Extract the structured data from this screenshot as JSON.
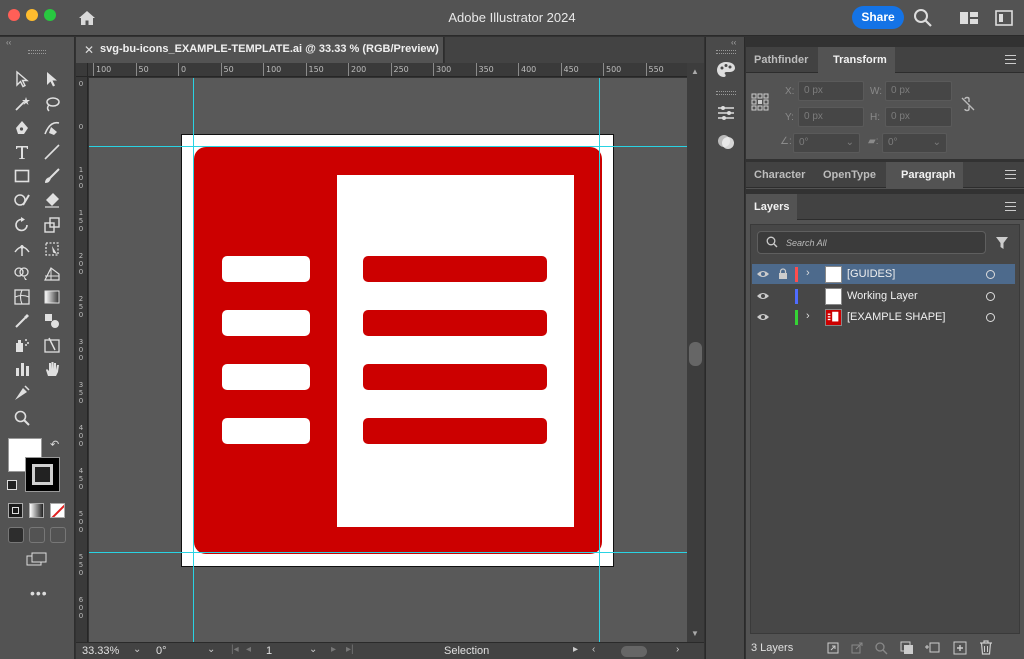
{
  "window": {
    "app_title": "Adobe Illustrator 2024",
    "share_label": "Share"
  },
  "document": {
    "tab_title": "svg-bu-icons_EXAMPLE-TEMPLATE.ai @ 33.33 % (RGB/Preview)",
    "close_glyph": "✕"
  },
  "rulers": {
    "horizontal_ticks": [
      "100",
      "50",
      "0",
      "50",
      "100",
      "150",
      "200",
      "250",
      "300",
      "350",
      "400",
      "450",
      "500",
      "550"
    ],
    "vertical_ticks": [
      "0",
      "0",
      "100",
      "150",
      "200",
      "250",
      "300",
      "350",
      "400",
      "450",
      "500",
      "550",
      "600"
    ]
  },
  "status_bar": {
    "zoom": "33.33%",
    "rotation": "0°",
    "artboard_number": "1",
    "tool_label": "Selection"
  },
  "transform_panel": {
    "tabs": [
      "Pathfinder",
      "Transform"
    ],
    "active_tab": "Transform",
    "x_label": "X:",
    "x_value": "0 px",
    "y_label": "Y:",
    "y_value": "0 px",
    "w_label": "W:",
    "w_value": "0 px",
    "h_label": "H:",
    "h_value": "0 px",
    "rotate_value": "0°",
    "shear_value": "0°"
  },
  "type_panel": {
    "tabs": [
      "Character",
      "OpenType",
      "Paragraph"
    ],
    "active_tab": "Paragraph"
  },
  "layers_panel": {
    "title": "Layers",
    "search_placeholder": "Search All",
    "layers": [
      {
        "name": "[GUIDES]",
        "color": "#ff4d4d",
        "selected": true,
        "locked": true,
        "expandable": true
      },
      {
        "name": "Working Layer",
        "color": "#4f6cff",
        "selected": false,
        "locked": false,
        "expandable": false
      },
      {
        "name": "[EXAMPLE SHAPE]",
        "color": "#35d335",
        "selected": false,
        "locked": false,
        "expandable": true
      }
    ],
    "count_label": "3 Layers"
  },
  "artwork": {
    "fill_color": "#cc0000",
    "background_color": "#ffffff",
    "guide_color": "#29d3e3"
  }
}
